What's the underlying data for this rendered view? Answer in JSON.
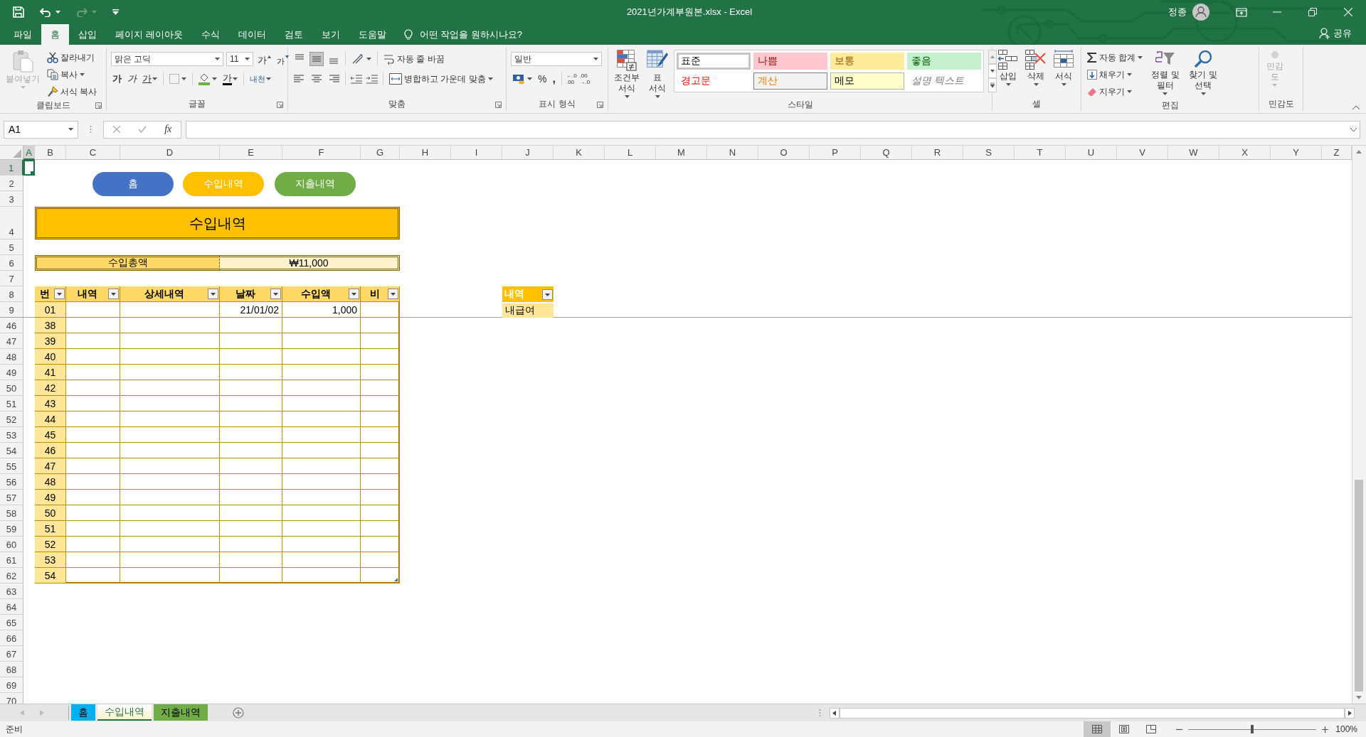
{
  "window": {
    "title": "2021년가계부원본.xlsx  -  Excel",
    "user": "정종"
  },
  "quick_access": [
    {
      "kind": "save",
      "disabled": false
    },
    {
      "kind": "undo",
      "disabled": false
    },
    {
      "kind": "redo",
      "disabled": true
    },
    {
      "kind": "customize",
      "disabled": false
    }
  ],
  "ribbon_tabs": [
    {
      "label": "파일",
      "selected": false
    },
    {
      "label": "홈",
      "selected": true
    },
    {
      "label": "삽입",
      "selected": false
    },
    {
      "label": "페이지 레이아웃",
      "selected": false
    },
    {
      "label": "수식",
      "selected": false
    },
    {
      "label": "데이터",
      "selected": false
    },
    {
      "label": "검토",
      "selected": false
    },
    {
      "label": "보기",
      "selected": false
    },
    {
      "label": "도움말",
      "selected": false
    }
  ],
  "tell_me": {
    "placeholder": "어떤 작업을 원하시나요?"
  },
  "share": "공유",
  "ribbon": {
    "clipboard": {
      "label": "클립보드",
      "paste": {
        "label": "붙여넣기",
        "disabled": true
      },
      "cut": "잘라내기",
      "copy": "복사",
      "format_painter": "서식 복사"
    },
    "font": {
      "label": "글꼴",
      "font_name": "맑은 고딕",
      "font_size": "11",
      "grow": "가",
      "shrink": "가",
      "bold": "가",
      "italic": "가",
      "underline": "가",
      "font_color": "가",
      "phonetic": "내천"
    },
    "alignment": {
      "label": "맞춤",
      "vertical": [
        {
          "selected": false
        },
        {
          "selected": true
        },
        {
          "selected": false
        }
      ],
      "wrap_text": "자동 줄 바꿈",
      "merge_center": "병합하고 가운데 맞춤"
    },
    "number": {
      "label": "표시 형식",
      "format": "일반",
      "percent": "%",
      "comma": ",",
      "increase_decimal": [
        "←.0",
        ".00"
      ],
      "decrease_decimal": [
        ".00",
        "→.0"
      ]
    },
    "styles": {
      "label": "스타일",
      "conditional": "조건부 서식",
      "table_format": "표 서식",
      "gallery": [
        {
          "label": "표준",
          "kind": "normal",
          "selected": true
        },
        {
          "label": "나쁨",
          "kind": "bad",
          "selected": false
        },
        {
          "label": "보통",
          "kind": "neutral",
          "selected": false
        },
        {
          "label": "좋음",
          "kind": "good",
          "selected": false
        },
        {
          "label": "경고문",
          "kind": "warning",
          "selected": false
        },
        {
          "label": "계산",
          "kind": "calculation",
          "selected": false
        },
        {
          "label": "메모",
          "kind": "note",
          "selected": false
        },
        {
          "label": "설명 텍스트",
          "kind": "explanatory",
          "selected": false
        }
      ]
    },
    "cells": {
      "label": "셀",
      "insert": "삽입",
      "delete": "삭제",
      "format": "서식"
    },
    "editing": {
      "label": "편집",
      "autosum": "자동 합계",
      "fill": "채우기",
      "clear": "지우기",
      "sort_filter": "정렬 및 필터",
      "find_select": "찾기 및 선택"
    },
    "sensitivity": {
      "label": "민감도",
      "button": "민감도",
      "disabled": true
    }
  },
  "formula_bar": {
    "name_box": "A1",
    "function": "fx"
  },
  "sheet": {
    "columns": [
      {
        "label": "A",
        "selected": true
      },
      {
        "label": "B",
        "selected": false
      },
      {
        "label": "C",
        "selected": false
      },
      {
        "label": "D",
        "selected": false
      },
      {
        "label": "E",
        "selected": false
      },
      {
        "label": "F",
        "selected": false
      },
      {
        "label": "G",
        "selected": false
      },
      {
        "label": "H",
        "selected": false
      },
      {
        "label": "I",
        "selected": false
      },
      {
        "label": "J",
        "selected": false
      },
      {
        "label": "K",
        "selected": false
      },
      {
        "label": "L",
        "selected": false
      },
      {
        "label": "M",
        "selected": false
      },
      {
        "label": "N",
        "selected": false
      },
      {
        "label": "O",
        "selected": false
      },
      {
        "label": "P",
        "selected": false
      },
      {
        "label": "Q",
        "selected": false
      },
      {
        "label": "R",
        "selected": false
      },
      {
        "label": "S",
        "selected": false
      },
      {
        "label": "T",
        "selected": false
      },
      {
        "label": "U",
        "selected": false
      },
      {
        "label": "V",
        "selected": false
      },
      {
        "label": "W",
        "selected": false
      },
      {
        "label": "X",
        "selected": false
      },
      {
        "label": "Y",
        "selected": false
      },
      {
        "label": "Z",
        "selected": false
      }
    ],
    "row_numbers": [
      {
        "label": "1",
        "selected": true
      },
      {
        "label": "2",
        "selected": false
      },
      {
        "label": "3",
        "selected": false
      },
      {
        "label": "4",
        "selected": false
      },
      {
        "label": "5",
        "selected": false
      },
      {
        "label": "6",
        "selected": false
      },
      {
        "label": "7",
        "selected": false
      },
      {
        "label": "8",
        "selected": false
      },
      {
        "label": "9",
        "selected": false
      },
      {
        "label": "46",
        "selected": false
      },
      {
        "label": "47",
        "selected": false
      },
      {
        "label": "48",
        "selected": false
      },
      {
        "label": "49",
        "selected": false
      },
      {
        "label": "50",
        "selected": false
      },
      {
        "label": "51",
        "selected": false
      },
      {
        "label": "52",
        "selected": false
      },
      {
        "label": "53",
        "selected": false
      },
      {
        "label": "54",
        "selected": false
      },
      {
        "label": "55",
        "selected": false
      },
      {
        "label": "56",
        "selected": false
      },
      {
        "label": "57",
        "selected": false
      },
      {
        "label": "58",
        "selected": false
      },
      {
        "label": "59",
        "selected": false
      },
      {
        "label": "60",
        "selected": false
      },
      {
        "label": "61",
        "selected": false
      },
      {
        "label": "62",
        "selected": false
      },
      {
        "label": "63",
        "selected": false
      },
      {
        "label": "64",
        "selected": false
      },
      {
        "label": "65",
        "selected": false
      },
      {
        "label": "66",
        "selected": false
      },
      {
        "label": "67",
        "selected": false
      },
      {
        "label": "68",
        "selected": false
      },
      {
        "label": "69",
        "selected": false
      },
      {
        "label": "70",
        "selected": false
      }
    ],
    "nav_buttons": [
      {
        "label": "홈",
        "color": "#4472c4"
      },
      {
        "label": "수입내역",
        "color": "#ffc000"
      },
      {
        "label": "지출내역",
        "color": "#70ad47"
      }
    ],
    "title": "수입내역",
    "summary": {
      "label": "수입총액",
      "value": "₩11,000"
    },
    "table": {
      "columns": [
        {
          "label": "번"
        },
        {
          "label": "내역"
        },
        {
          "label": "상세내역"
        },
        {
          "label": "날짜"
        },
        {
          "label": "수입액"
        },
        {
          "label": "비"
        }
      ],
      "rows": [
        {
          "number": "01",
          "date": "21/01/02",
          "amount": "1,000"
        },
        {
          "number": "38"
        },
        {
          "number": "39"
        },
        {
          "number": "40"
        },
        {
          "number": "41"
        },
        {
          "number": "42"
        },
        {
          "number": "43"
        },
        {
          "number": "44"
        },
        {
          "number": "45"
        },
        {
          "number": "46"
        },
        {
          "number": "47"
        },
        {
          "number": "48"
        },
        {
          "number": "49"
        },
        {
          "number": "50"
        },
        {
          "number": "51"
        },
        {
          "number": "52"
        },
        {
          "number": "53"
        },
        {
          "number": "54"
        }
      ]
    },
    "side_table": {
      "header": "내역",
      "rows": [
        "내급여"
      ]
    }
  },
  "sheet_tabs": [
    {
      "label": "홈",
      "selected": false,
      "color": "#00b0f0"
    },
    {
      "label": "수입내역",
      "selected": true,
      "color": "#fff2cc"
    },
    {
      "label": "지출내역",
      "selected": false,
      "color": "#70ad47"
    }
  ],
  "status_bar": {
    "text": "준비",
    "views": [
      {
        "selected": true
      },
      {
        "selected": false
      },
      {
        "selected": false
      }
    ],
    "zoom_slider": {
      "level": 0.5
    },
    "zoom": "100%"
  }
}
